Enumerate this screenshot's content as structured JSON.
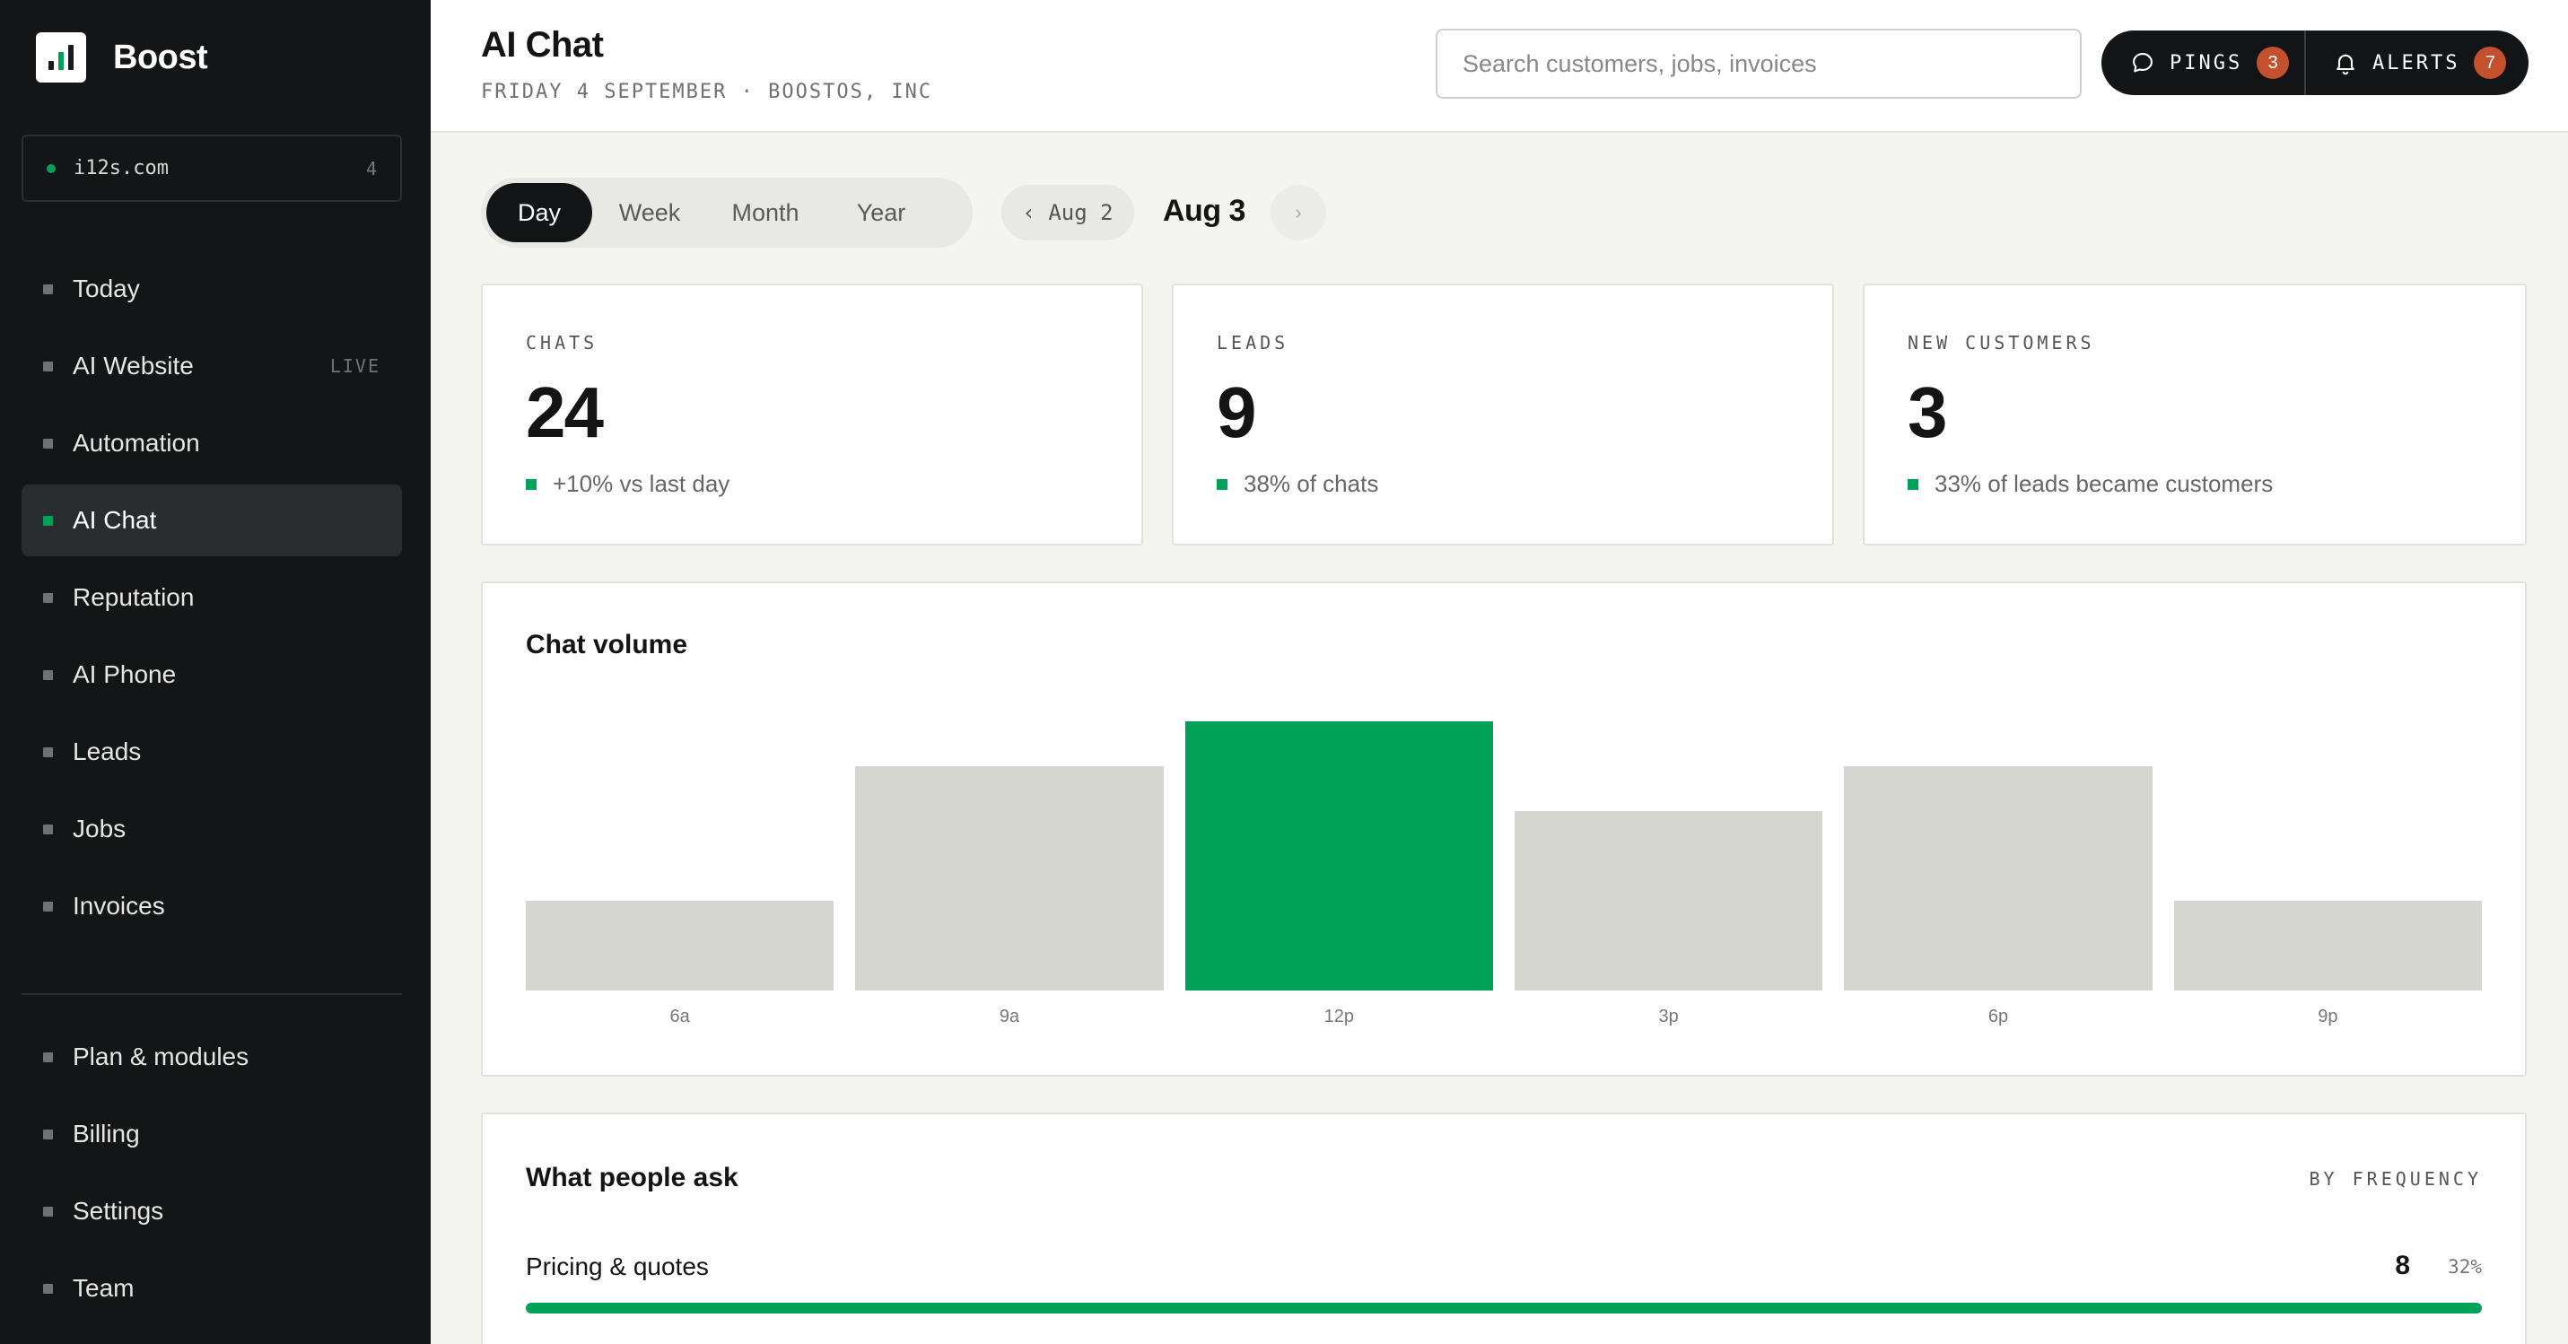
{
  "brand": {
    "name": "Boost"
  },
  "workspace": {
    "domain": "i12s.com",
    "count": "4"
  },
  "sidebar": {
    "items": [
      {
        "label": "Today",
        "badge": ""
      },
      {
        "label": "AI Website",
        "badge": "LIVE"
      },
      {
        "label": "Automation",
        "badge": ""
      },
      {
        "label": "AI Chat",
        "badge": "",
        "active": true
      },
      {
        "label": "Reputation",
        "badge": ""
      },
      {
        "label": "AI Phone",
        "badge": ""
      },
      {
        "label": "Leads",
        "badge": ""
      },
      {
        "label": "Jobs",
        "badge": ""
      },
      {
        "label": "Invoices",
        "badge": ""
      }
    ],
    "bottom_items": [
      {
        "label": "Plan & modules"
      },
      {
        "label": "Billing"
      },
      {
        "label": "Settings"
      },
      {
        "label": "Team"
      }
    ]
  },
  "header": {
    "title": "AI Chat",
    "subtitle": "FRIDAY 4 SEPTEMBER · BOOSTOS, INC",
    "search_placeholder": "Search customers, jobs, invoices",
    "pings_label": "PINGS",
    "pings_count": "3",
    "alerts_label": "ALERTS",
    "alerts_count": "7"
  },
  "period": {
    "options": [
      "Day",
      "Week",
      "Month",
      "Year"
    ],
    "selected": "Day",
    "prev_label": "‹ Aug 2",
    "current_label": "Aug 3",
    "next_label": "›"
  },
  "stats": [
    {
      "label": "CHATS",
      "value": "24",
      "note": "+10% vs last day"
    },
    {
      "label": "LEADS",
      "value": "9",
      "note": "38% of chats"
    },
    {
      "label": "NEW CUSTOMERS",
      "value": "3",
      "note": "33% of leads became customers"
    }
  ],
  "chart_data": {
    "type": "bar",
    "title": "Chat volume",
    "categories": [
      "6a",
      "9a",
      "12p",
      "3p",
      "6p",
      "9p"
    ],
    "values": [
      2,
      5,
      6,
      4,
      5,
      2
    ],
    "highlight_index": 2,
    "colors": {
      "default": "#d6d6d0",
      "highlight": "#00a257"
    }
  },
  "questions": {
    "title": "What people ask",
    "sort_label": "BY FREQUENCY",
    "rows": [
      {
        "label": "Pricing & quotes",
        "count": "8",
        "percent_label": "32%",
        "fill": 1.0
      }
    ]
  },
  "colors": {
    "accent": "#00a257",
    "badge": "#c4512e",
    "sidebar": "#131517"
  }
}
